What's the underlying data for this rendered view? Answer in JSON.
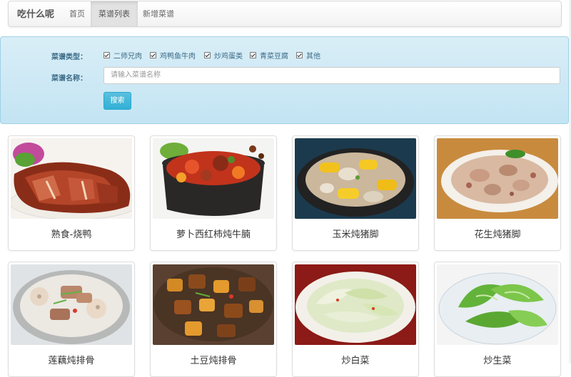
{
  "navbar": {
    "brand": "吃什么呢",
    "items": [
      {
        "label": "首页",
        "active": false
      },
      {
        "label": "菜谱列表",
        "active": true
      },
      {
        "label": "新增菜谱",
        "active": false
      }
    ]
  },
  "search": {
    "type_label": "菜谱类型：",
    "types": [
      {
        "label": "二师兄肉",
        "checked": true
      },
      {
        "label": "鸡鸭鱼牛肉",
        "checked": true
      },
      {
        "label": "炒鸡蛋类",
        "checked": true
      },
      {
        "label": "青菜豆腐",
        "checked": true
      },
      {
        "label": "其他",
        "checked": true
      }
    ],
    "name_label": "菜谱名称：",
    "name_placeholder": "请输入菜谱名称",
    "button_label": "搜索"
  },
  "recipes": [
    {
      "name": "熟食-烧鸭"
    },
    {
      "name": "萝卜西红柿炖牛腩"
    },
    {
      "name": "玉米炖猪脚"
    },
    {
      "name": "花生炖猪脚"
    },
    {
      "name": "莲藕炖排骨"
    },
    {
      "name": "土豆炖排骨"
    },
    {
      "name": "炒白菜"
    },
    {
      "name": "炒生菜"
    }
  ],
  "colors": {
    "panel_bg": "#c9e7f5",
    "button_info": "#31b0d5",
    "label_text": "#3a6a86"
  }
}
